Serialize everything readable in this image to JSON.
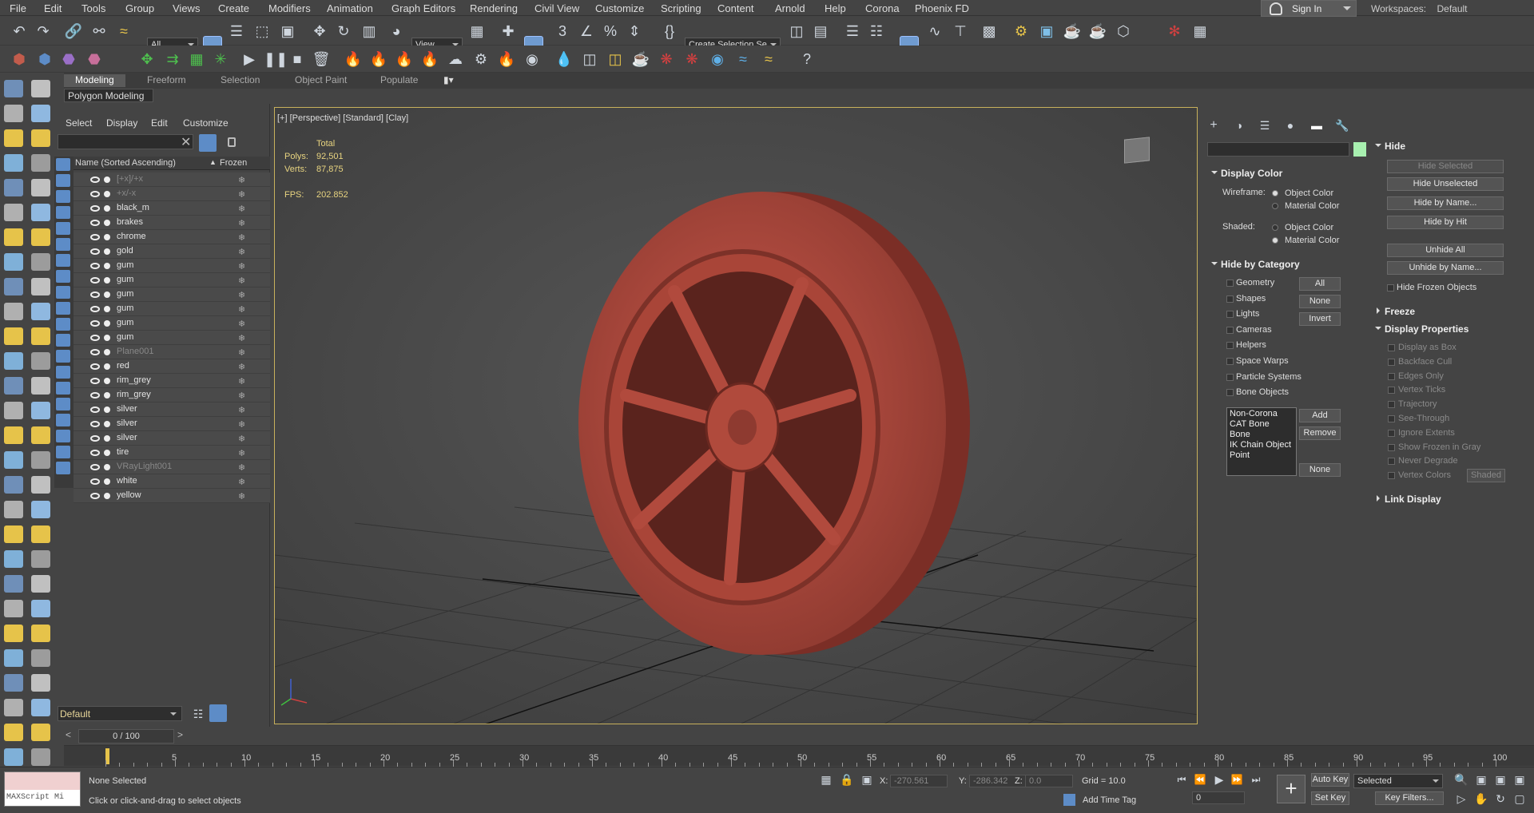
{
  "menubar": {
    "items": [
      "File",
      "Edit",
      "Tools",
      "Group",
      "Views",
      "Create",
      "Modifiers",
      "Animation",
      "Graph Editors",
      "Rendering",
      "Civil View",
      "Customize",
      "Scripting",
      "Content",
      "Arnold",
      "Help",
      "Corona",
      "Phoenix FD"
    ],
    "sign_in": "Sign In",
    "workspaces_label": "Workspaces:",
    "workspace_value": "Default"
  },
  "toolbar": {
    "selection_filter": "All",
    "ref_coord": "View",
    "named_selection": "Create Selection Se"
  },
  "ribbon": {
    "tabs": [
      "Modeling",
      "Freeform",
      "Selection",
      "Object Paint",
      "Populate"
    ],
    "active_tab": "Modeling",
    "sub_panel": "Polygon Modeling"
  },
  "scene_explorer": {
    "menu": [
      "Select",
      "Display",
      "Edit",
      "Customize"
    ],
    "col_name": "Name (Sorted Ascending)",
    "col_frozen": "Frozen",
    "rows": [
      {
        "name": "[+x]/+x",
        "dim": true
      },
      {
        "name": "+x/-x",
        "dim": true
      },
      {
        "name": "black_m",
        "dim": false
      },
      {
        "name": "brakes",
        "dim": false
      },
      {
        "name": "chrome",
        "dim": false
      },
      {
        "name": "gold",
        "dim": false
      },
      {
        "name": "gum",
        "dim": false
      },
      {
        "name": "gum",
        "dim": false
      },
      {
        "name": "gum",
        "dim": false
      },
      {
        "name": "gum",
        "dim": false
      },
      {
        "name": "gum",
        "dim": false
      },
      {
        "name": "gum",
        "dim": false
      },
      {
        "name": "Plane001",
        "dim": true
      },
      {
        "name": "red",
        "dim": false
      },
      {
        "name": "rim_grey",
        "dim": false
      },
      {
        "name": "rim_grey",
        "dim": false
      },
      {
        "name": "silver",
        "dim": false
      },
      {
        "name": "silver",
        "dim": false
      },
      {
        "name": "silver",
        "dim": false
      },
      {
        "name": "tire",
        "dim": false
      },
      {
        "name": "VRayLight001",
        "dim": true
      },
      {
        "name": "white",
        "dim": false
      },
      {
        "name": "yellow",
        "dim": false
      }
    ],
    "layer": "Default"
  },
  "viewport": {
    "label": "[+] [Perspective] [Standard] [Clay]",
    "stats_header": "Total",
    "polys_label": "Polys:",
    "polys": "92,501",
    "verts_label": "Verts:",
    "verts": "87,875",
    "fps_label": "FPS:",
    "fps": "202.852"
  },
  "display_panel": {
    "display_color": {
      "title": "Display Color",
      "wireframe_label": "Wireframe:",
      "shaded_label": "Shaded:",
      "object_color": "Object Color",
      "material_color": "Material Color"
    },
    "hide_by_category": {
      "title": "Hide by Category",
      "items": [
        "Geometry",
        "Shapes",
        "Lights",
        "Cameras",
        "Helpers",
        "Space Warps",
        "Particle Systems",
        "Bone Objects"
      ],
      "btn_all": "All",
      "btn_none": "None",
      "btn_invert": "Invert",
      "list": [
        "Non-Corona",
        "CAT Bone",
        "Bone",
        "IK Chain Object",
        "Point"
      ],
      "btn_add": "Add",
      "btn_remove": "Remove",
      "btn_none2": "None"
    },
    "hide": {
      "title": "Hide",
      "hide_selected": "Hide Selected",
      "hide_unselected": "Hide Unselected",
      "hide_by_name": "Hide by Name...",
      "hide_by_hit": "Hide by Hit",
      "unhide_all": "Unhide All",
      "unhide_by_name": "Unhide by Name...",
      "hide_frozen": "Hide Frozen Objects"
    },
    "freeze_title": "Freeze",
    "display_props": {
      "title": "Display Properties",
      "items": [
        "Display as Box",
        "Backface Cull",
        "Edges Only",
        "Vertex Ticks",
        "Trajectory",
        "See-Through",
        "Ignore Extents",
        "Show Frozen in Gray",
        "Never Degrade",
        "Vertex Colors"
      ],
      "shaded_btn": "Shaded"
    },
    "link_display_title": "Link Display"
  },
  "timeline": {
    "slider": "0 / 100",
    "ticks": [
      "5",
      "10",
      "15",
      "20",
      "25",
      "30",
      "35",
      "40",
      "45",
      "50",
      "55",
      "60",
      "65",
      "70",
      "75",
      "80",
      "85",
      "90",
      "95",
      "100"
    ]
  },
  "status": {
    "maxscript": "MAXScript Mi",
    "selection": "None Selected",
    "prompt": "Click or click-and-drag to select objects",
    "x_label": "X:",
    "x_value": "-270.561",
    "y_label": "Y:",
    "y_value": "-286.342",
    "z_label": "Z:",
    "z_value": "0.0",
    "grid": "Grid = 10.0",
    "add_time_tag": "Add Time Tag",
    "auto_key": "Auto Key",
    "set_key": "Set Key",
    "selected": "Selected",
    "key_filters": "Key Filters...",
    "frame": "0"
  },
  "colors": {
    "tire_clay": "#b04a3c",
    "selection_blue": "#5d8cc7",
    "viewport_border": "#c8b15c"
  }
}
